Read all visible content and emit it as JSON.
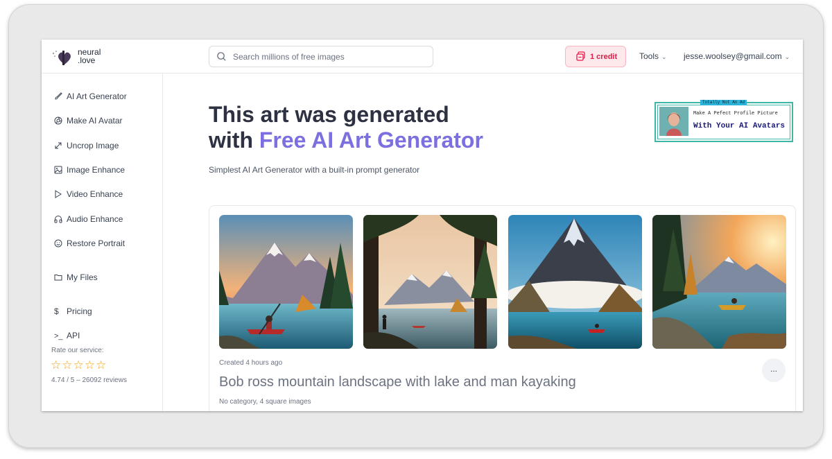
{
  "header": {
    "logo_line1": "neural",
    "logo_line2": ".love",
    "search_placeholder": "Search millions of free images",
    "credit_label": "1 credit",
    "tools_label": "Tools",
    "user_email": "jesse.woolsey@gmail.com"
  },
  "sidebar": {
    "items": [
      {
        "label": "AI Art Generator",
        "icon": "brush-icon"
      },
      {
        "label": "Make AI Avatar",
        "icon": "aperture-icon"
      },
      {
        "label": "Uncrop Image",
        "icon": "expand-icon"
      },
      {
        "label": "Image Enhance",
        "icon": "image-icon"
      },
      {
        "label": "Video Enhance",
        "icon": "play-icon"
      },
      {
        "label": "Audio Enhance",
        "icon": "headphones-icon"
      },
      {
        "label": "Restore Portrait",
        "icon": "smile-icon"
      },
      {
        "label": "My Files",
        "icon": "folder-icon"
      },
      {
        "label": "Pricing",
        "icon": "dollar-icon"
      },
      {
        "label": "API",
        "icon": "terminal-icon"
      }
    ],
    "rate_title": "Rate our service:",
    "stars": 5,
    "rating_text": "4.74 / 5 – 26092 reviews"
  },
  "hero": {
    "title_line1": "This art was generated",
    "title_prefix": "with ",
    "title_accent": "Free AI Art Generator",
    "subtitle": "Simplest AI Art Generator with a built-in prompt generator"
  },
  "ad": {
    "tag": "Totally Not An Ad",
    "line1": "Make A Pefect Profile Picture",
    "line2": "With Your AI Avatars"
  },
  "result": {
    "created": "Created 4 hours ago",
    "prompt": "Bob ross mountain landscape with lake and man kayaking",
    "meta": "No category, 4 square images",
    "more_label": "..."
  },
  "colors": {
    "accent": "#7c6fe0",
    "credit": "#e11d48",
    "star": "#f59e0b"
  }
}
